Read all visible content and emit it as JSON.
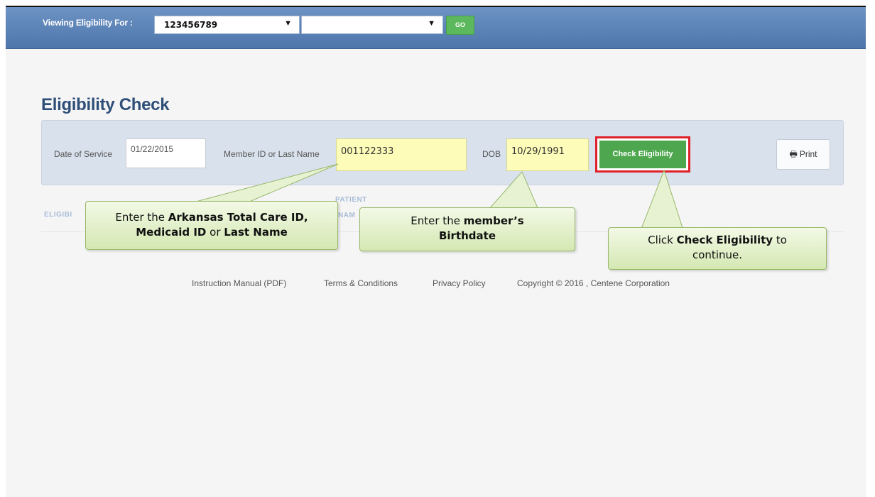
{
  "topbar": {
    "viewing_label": "Viewing Eligibility For :",
    "provider_select_value": "123456789",
    "secondary_select_value": "",
    "go_label": "GO"
  },
  "page_title": "Eligibility Check",
  "form": {
    "date_of_service_label": "Date of Service",
    "date_of_service_value": "01/22/2015",
    "member_label": "Member ID or Last Name",
    "member_value": "001122333",
    "dob_label": "DOB",
    "dob_value": "10/29/1991",
    "check_label": "Check Eligibility",
    "print_label": "Print"
  },
  "results_headers": {
    "eligibility": "ELIGIBI",
    "patient_line1": "PATIENT",
    "patient_line2": "NAM"
  },
  "callouts": {
    "member": {
      "line1_prefix": "Enter the ",
      "line1_bold": "Arkansas Total Care ID,",
      "line2_bold1": "Medicaid ID",
      "line2_mid": " or ",
      "line2_bold2": "Last Name"
    },
    "dob": {
      "line1_prefix": "Enter the ",
      "line1_bold": "member’s",
      "line2_bold": "Birthdate"
    },
    "check": {
      "line1_prefix": "Click ",
      "line1_bold": "Check Eligibility",
      "line1_suffix": " to",
      "line2": "continue."
    }
  },
  "footer": {
    "manual": "Instruction Manual (PDF)",
    "terms": "Terms & Conditions",
    "privacy": "Privacy Policy",
    "copyright": "Copyright © 2016 , Centene Corporation"
  },
  "colors": {
    "topbar": "#5a80b6",
    "title": "#2f4f78",
    "highlight_field": "#fdfcb8",
    "check_button": "#4ea74e",
    "outline": "#e0202a",
    "callout": "#e2f0c9"
  },
  "icons": {
    "print": "printer-icon",
    "caret": "caret-down-icon"
  }
}
